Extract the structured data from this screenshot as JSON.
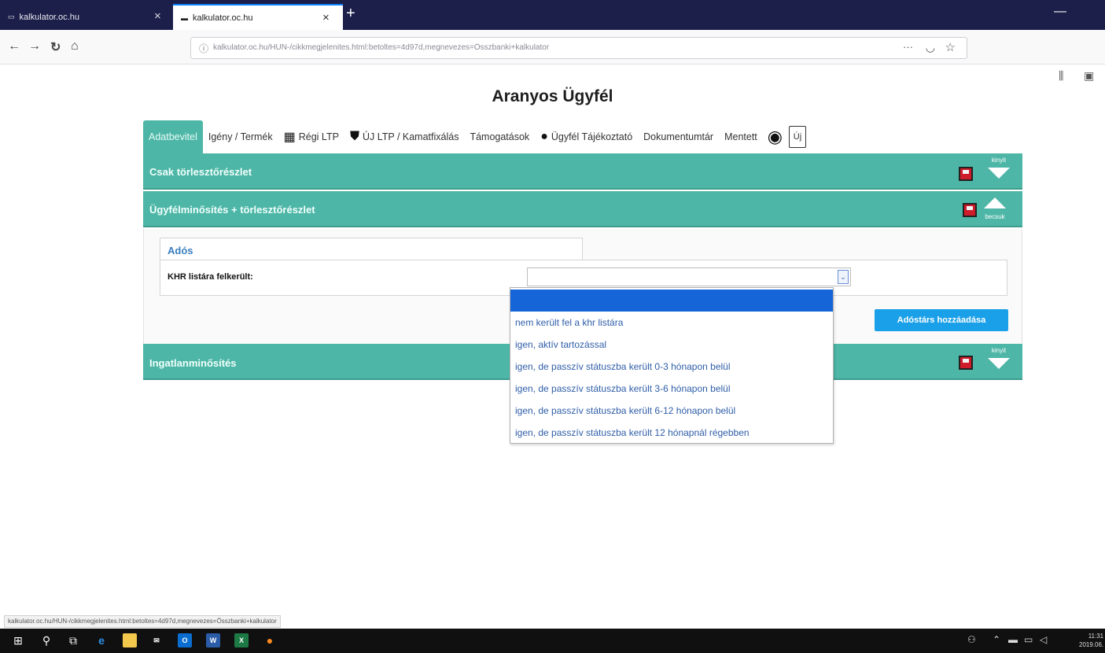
{
  "browser": {
    "tabs": [
      {
        "title": "kalkulator.oc.hu",
        "close": "×"
      },
      {
        "title": "kalkulator.oc.hu",
        "close": "×"
      }
    ],
    "new_tab": "+",
    "minimize": "—",
    "url": "kalkulator.oc.hu/HUN-/cikkmegjelenites.html:betoltes=4d97d,megnevezes=Összbanki+kalkulator",
    "url_actions": {
      "more": "···"
    },
    "status_url": "kalkulator.oc.hu/HUN-/cikkmegjelenites.html:betoltes=4d97d,megnevezes=Összbanki+kalkulator"
  },
  "page": {
    "title": "Aranyos Ügyfél",
    "tabs": [
      {
        "label": "Adatbevitel",
        "active": true
      },
      {
        "label": "Igény / Termék"
      },
      {
        "label": "Régi LTP"
      },
      {
        "label": "ÚJ LTP / Kamatfixálás"
      },
      {
        "label": "Támogatások"
      },
      {
        "label": "Ügyfél Tájékoztató"
      },
      {
        "label": "Dokumentumtár"
      },
      {
        "label": "Mentett"
      }
    ],
    "new_doc_icon_label": "Új",
    "sections": {
      "s1": {
        "title": "Csak törlesztőrészlet",
        "toggle": "kinyit"
      },
      "s2": {
        "title": "Ügyfélminősítés + törlesztőrészlet",
        "toggle": "becsuk"
      },
      "s3": {
        "title": "Ingatlanminősítés",
        "toggle": "kinyit"
      }
    },
    "ados": {
      "tab_label": "Adós",
      "khr_label": "KHR listára felkerült:",
      "select_value": "",
      "add_button": "Adóstárs hozzáadása"
    },
    "dropdown_options": [
      "",
      "nem került fel a khr listára",
      "igen, aktív tartozással",
      "igen, de passzív státuszba került 0-3 hónapon belül",
      "igen, de passzív státuszba került 3-6 hónapon belül",
      "igen, de passzív státuszba került 6-12 hónapon belül",
      "igen, de passzív státuszba került 12 hónapnál régebben"
    ]
  },
  "taskbar": {
    "clock_time": "11:31",
    "clock_date": "2019.06."
  },
  "colors": {
    "teal": "#4db6a6",
    "select_blue": "#1565d8",
    "button_blue": "#1aa0e8",
    "save_red": "#cf1c2b"
  }
}
